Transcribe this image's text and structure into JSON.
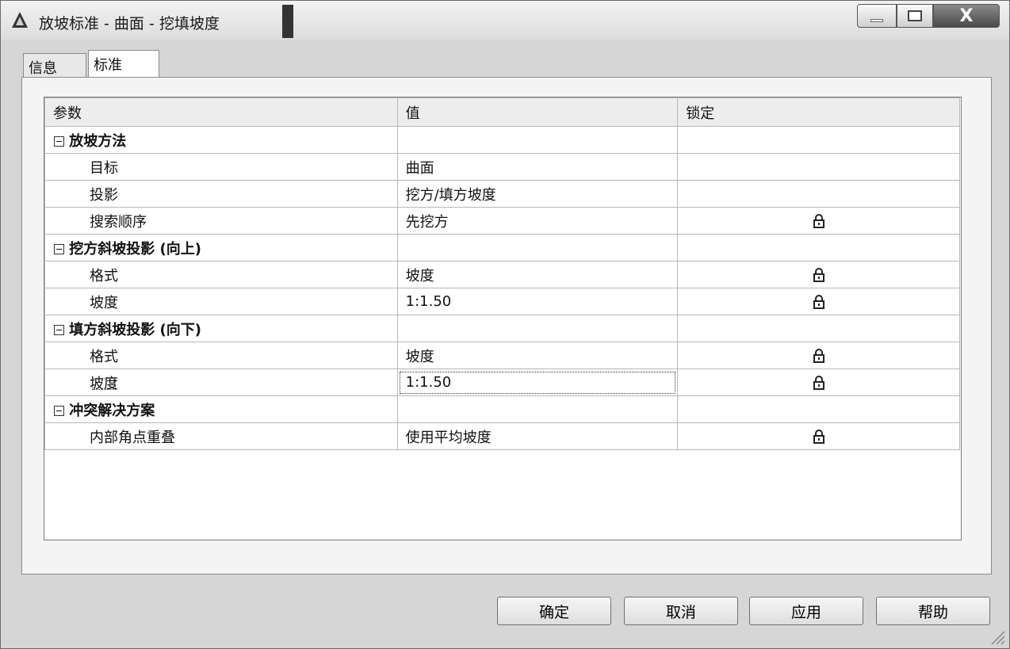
{
  "window": {
    "title": "放坡标准 - 曲面 - 挖填坡度",
    "close_glyph": "X"
  },
  "tabs": [
    {
      "label": "信息"
    },
    {
      "label": "标准"
    }
  ],
  "grid": {
    "headers": [
      "参数",
      "值",
      "锁定"
    ],
    "rows": [
      {
        "type": "group",
        "label": "放坡方法",
        "value": "",
        "locked": false
      },
      {
        "type": "item",
        "label": "目标",
        "value": "曲面",
        "locked": false
      },
      {
        "type": "item",
        "label": "投影",
        "value": "挖方/填方坡度",
        "locked": false
      },
      {
        "type": "item",
        "label": "搜索顺序",
        "value": "先挖方",
        "locked": true
      },
      {
        "type": "group",
        "label": "挖方斜坡投影 (向上)",
        "value": "",
        "locked": false
      },
      {
        "type": "item",
        "label": "格式",
        "value": "坡度",
        "locked": true
      },
      {
        "type": "item",
        "label": "坡度",
        "value": "1:1.50",
        "locked": true
      },
      {
        "type": "group",
        "label": "填方斜坡投影 (向下)",
        "value": "",
        "locked": false
      },
      {
        "type": "item",
        "label": "格式",
        "value": "坡度",
        "locked": true
      },
      {
        "type": "item",
        "label": "坡度",
        "value": "1:1.50",
        "locked": true
      },
      {
        "type": "group",
        "label": "冲突解决方案",
        "value": "",
        "locked": false
      },
      {
        "type": "item",
        "label": "内部角点重叠",
        "value": "使用平均坡度",
        "locked": true
      }
    ]
  },
  "buttons": {
    "ok": "确定",
    "cancel": "取消",
    "apply": "应用",
    "help": "帮助"
  }
}
